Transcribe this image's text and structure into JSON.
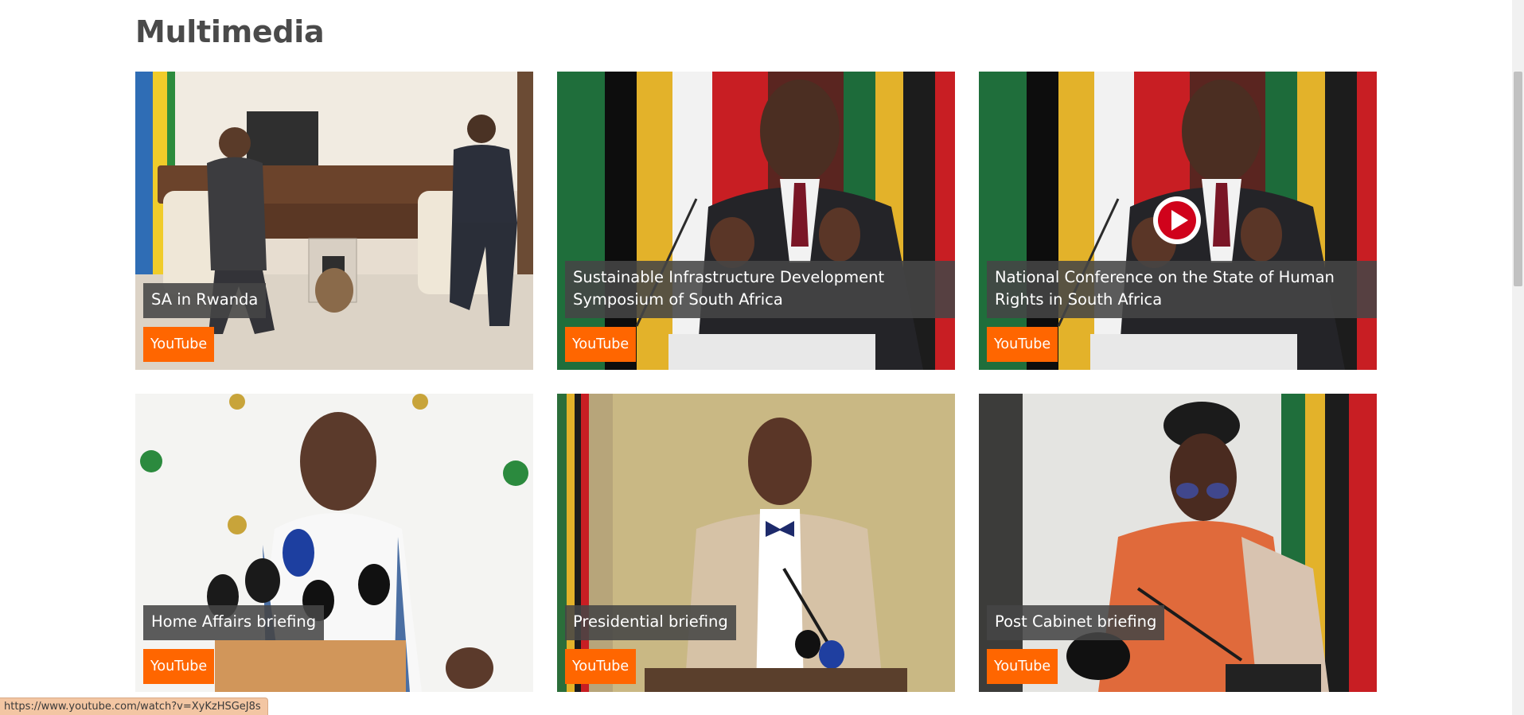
{
  "section": {
    "title": "Multimedia"
  },
  "cards": [
    {
      "title": "SA in Rwanda",
      "badge": "YouTube"
    },
    {
      "title": "Sustainable Infrastructure Development Symposium of South Africa",
      "badge": "YouTube"
    },
    {
      "title": "National Conference on the State of Human Rights in South Africa",
      "badge": "YouTube",
      "hover_play_icon": "play-circle-icon"
    },
    {
      "title": "Home Affairs briefing",
      "badge": "YouTube"
    },
    {
      "title": "Presidential briefing",
      "badge": "YouTube"
    },
    {
      "title": "Post Cabinet briefing",
      "badge": "YouTube"
    }
  ],
  "status_bar": {
    "url": "https://www.youtube.com/watch?v=XyKzHSGeJ8s"
  },
  "colors": {
    "badge": "#ff6600",
    "caption_bg": "#464646",
    "title": "#4a4a4a",
    "play_red": "#d0021b"
  }
}
